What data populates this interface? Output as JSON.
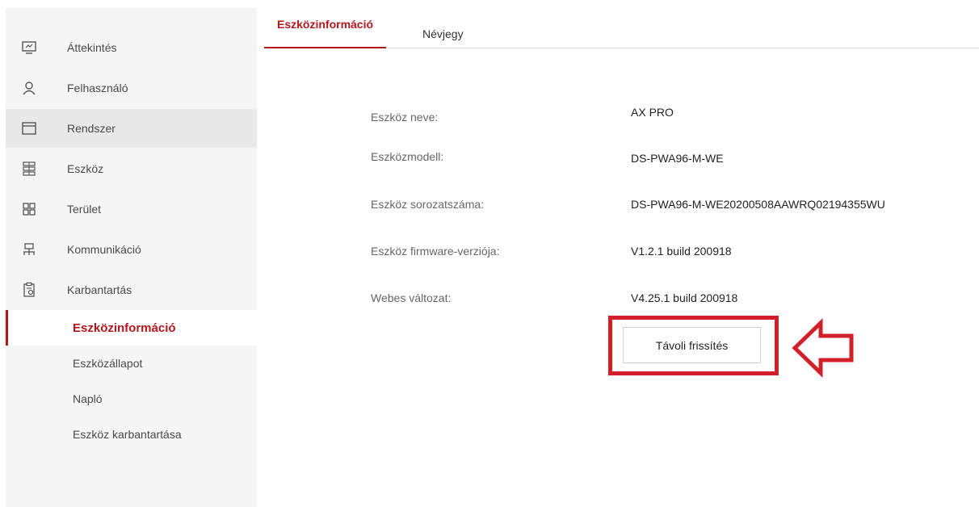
{
  "sidebar": {
    "items": [
      {
        "label": "Áttekintés",
        "icon": "monitor-icon"
      },
      {
        "label": "Felhasználó",
        "icon": "user-icon"
      },
      {
        "label": "Rendszer",
        "icon": "window-icon"
      },
      {
        "label": "Eszköz",
        "icon": "device-grid-icon"
      },
      {
        "label": "Terület",
        "icon": "area-grid-icon"
      },
      {
        "label": "Kommunikáció",
        "icon": "network-icon"
      },
      {
        "label": "Karbantartás",
        "icon": "maintenance-clipboard-icon"
      }
    ],
    "subitems": [
      {
        "label": "Eszközinformáció"
      },
      {
        "label": "Eszközállapot"
      },
      {
        "label": "Napló"
      },
      {
        "label": "Eszköz karbantartása"
      }
    ]
  },
  "tabs": [
    {
      "label": "Eszközinformáció"
    },
    {
      "label": "Névjegy"
    }
  ],
  "info": {
    "rows": [
      {
        "label": "Eszköz neve:",
        "value": "AX PRO"
      },
      {
        "label": "Eszközmodell:",
        "value": "DS-PWA96-M-WE"
      },
      {
        "label": "Eszköz sorozatszáma:",
        "value": "DS-PWA96-M-WE20200508AAWRQ02194355WU"
      },
      {
        "label": "Eszköz firmware-verziója:",
        "value": "V1.2.1 build 200918"
      },
      {
        "label": "Webes változat:",
        "value": "V4.25.1 build 200918"
      }
    ]
  },
  "actions": {
    "remote_update_label": "Távoli frissítés"
  },
  "colors": {
    "accent": "#b3171c",
    "highlight": "#d1202a"
  }
}
